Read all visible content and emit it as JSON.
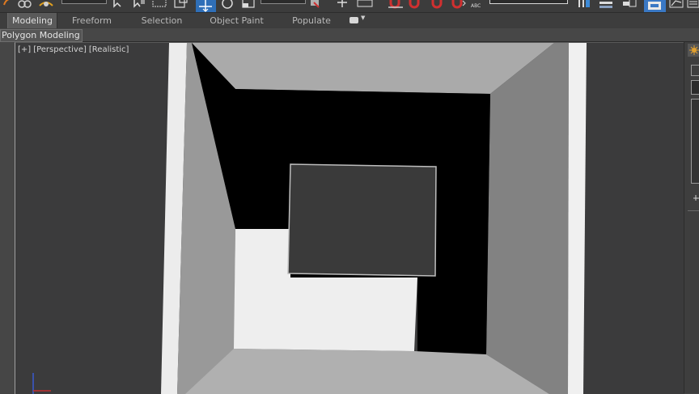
{
  "ribbon": {
    "tabs": [
      {
        "label": "Modeling",
        "active": true
      },
      {
        "label": "Freeform",
        "active": false
      },
      {
        "label": "Selection",
        "active": false
      },
      {
        "label": "Object Paint",
        "active": false
      },
      {
        "label": "Populate",
        "active": false
      }
    ],
    "panel_label": "Polygon Modeling"
  },
  "viewport": {
    "menu_label": "[+]",
    "view_label": "[Perspective]",
    "shading_label": "[Realistic]"
  },
  "toolbar_small_text": "ABC",
  "colors": {
    "ui_bg": "#444444",
    "viewport_bg": "#3b3b3c",
    "active_tab": "#5a5a5a",
    "highlight_blue": "#3d8bd8",
    "magnet_red": "#d03030"
  }
}
